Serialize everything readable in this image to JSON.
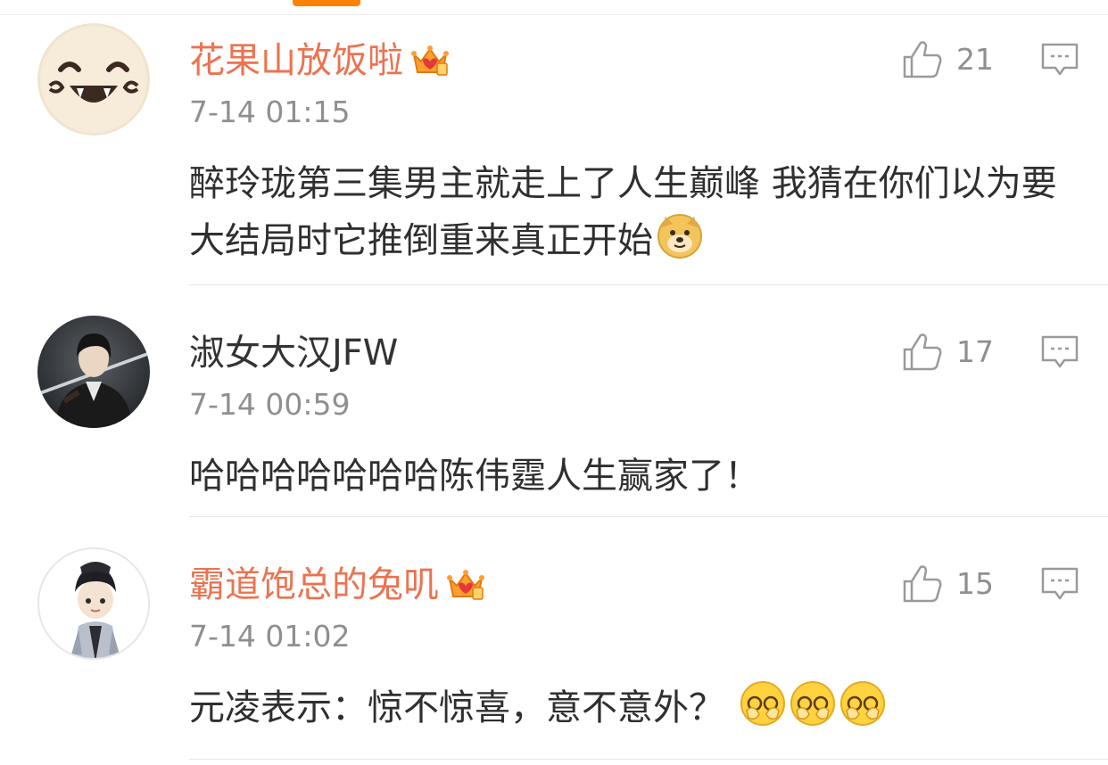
{
  "colors": {
    "accent": "#ff8200",
    "vip_name": "#eb7350",
    "muted": "#8f8f8f",
    "text": "#2f2f2f"
  },
  "comments": [
    {
      "username": "花果山放饭啦",
      "vip": true,
      "time": "7-14 01:15",
      "text": "醉玲珑第三集男主就走上了人生巅峰 我猜在你们以为要大结局时它推倒重来真正开始",
      "emojis": [
        "doge-emoji"
      ],
      "likes": "21",
      "avatar": "smiling-face-avatar"
    },
    {
      "username": "淑女大汉JFW",
      "vip": false,
      "time": "7-14 00:59",
      "text": "哈哈哈哈哈哈哈陈伟霆人生赢家了！",
      "emojis": [],
      "likes": "17",
      "avatar": "swordsman-avatar"
    },
    {
      "username": "霸道饱总的兔叽",
      "vip": true,
      "time": "7-14 01:02",
      "text": "元凌表示：惊不惊喜，意不意外？",
      "emojis": [
        "cover-face-emoji",
        "cover-face-emoji",
        "cover-face-emoji"
      ],
      "likes": "15",
      "avatar": "ancient-costume-avatar"
    }
  ],
  "icons": {
    "like": "thumbs-up-icon",
    "reply": "comment-bubble-icon",
    "vip": "vip-crown-icon"
  }
}
